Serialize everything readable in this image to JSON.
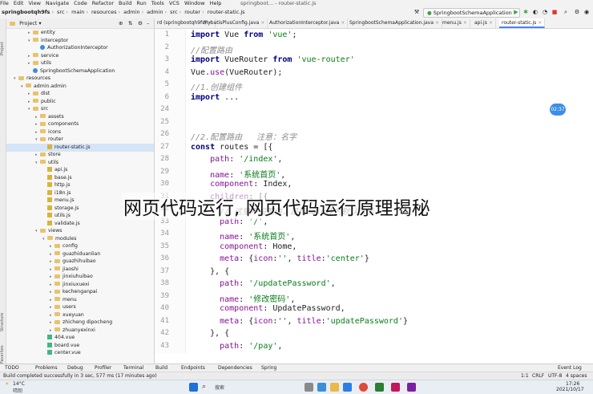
{
  "menubar": {
    "items": [
      "File",
      "Edit",
      "View",
      "Navigate",
      "Code",
      "Refactor",
      "Build",
      "Run",
      "Tools",
      "VCS",
      "Window",
      "Help"
    ],
    "title": "springboot... - router-static.js"
  },
  "navbar": {
    "crumbs": [
      "springbootqh9fs",
      "src",
      "main",
      "resources",
      "admin",
      "admin",
      "src",
      "router",
      "router-static.js"
    ],
    "run_config": "SpringbootSchemaApplication"
  },
  "project_panel": {
    "header": "Project",
    "tree": [
      {
        "label": "entity",
        "type": "folder",
        "indent": 3,
        "arrow": "▸"
      },
      {
        "label": "interceptor",
        "type": "folder",
        "indent": 3,
        "arrow": "▾"
      },
      {
        "label": "AuthorizationInterceptor",
        "type": "class",
        "indent": 4,
        "arrow": ""
      },
      {
        "label": "service",
        "type": "folder",
        "indent": 3,
        "arrow": "▸"
      },
      {
        "label": "utils",
        "type": "folder",
        "indent": 3,
        "arrow": "▸"
      },
      {
        "label": "SpringbootSchemaApplication",
        "type": "class",
        "indent": 3,
        "arrow": ""
      },
      {
        "label": "resources",
        "type": "folder",
        "indent": 1,
        "arrow": "▾"
      },
      {
        "label": "admin.admin",
        "type": "folder",
        "indent": 2,
        "arrow": "▾"
      },
      {
        "label": "dist",
        "type": "folder",
        "indent": 3,
        "arrow": "▸"
      },
      {
        "label": "public",
        "type": "folder",
        "indent": 3,
        "arrow": "▸"
      },
      {
        "label": "src",
        "type": "folder",
        "indent": 3,
        "arrow": "▾"
      },
      {
        "label": "assets",
        "type": "folder",
        "indent": 4,
        "arrow": "▸"
      },
      {
        "label": "components",
        "type": "folder",
        "indent": 4,
        "arrow": "▸"
      },
      {
        "label": "icons",
        "type": "folder",
        "indent": 4,
        "arrow": "▸"
      },
      {
        "label": "router",
        "type": "folder",
        "indent": 4,
        "arrow": "▾"
      },
      {
        "label": "router-static.js",
        "type": "js",
        "indent": 5,
        "arrow": "",
        "selected": true
      },
      {
        "label": "store",
        "type": "folder",
        "indent": 4,
        "arrow": "▸"
      },
      {
        "label": "utils",
        "type": "folder",
        "indent": 4,
        "arrow": "▾"
      },
      {
        "label": "api.js",
        "type": "js",
        "indent": 5,
        "arrow": ""
      },
      {
        "label": "base.js",
        "type": "js",
        "indent": 5,
        "arrow": ""
      },
      {
        "label": "http.js",
        "type": "js",
        "indent": 5,
        "arrow": ""
      },
      {
        "label": "i18n.js",
        "type": "js",
        "indent": 5,
        "arrow": ""
      },
      {
        "label": "menu.js",
        "type": "js",
        "indent": 5,
        "arrow": ""
      },
      {
        "label": "storage.js",
        "type": "js",
        "indent": 5,
        "arrow": ""
      },
      {
        "label": "utils.js",
        "type": "js",
        "indent": 5,
        "arrow": ""
      },
      {
        "label": "validate.js",
        "type": "js",
        "indent": 5,
        "arrow": ""
      },
      {
        "label": "views",
        "type": "folder",
        "indent": 4,
        "arrow": "▾"
      },
      {
        "label": "modules",
        "type": "folder",
        "indent": 5,
        "arrow": "▾"
      },
      {
        "label": "config",
        "type": "folder",
        "indent": 6,
        "arrow": "▸"
      },
      {
        "label": "guazhiduanlian",
        "type": "folder",
        "indent": 6,
        "arrow": "▸"
      },
      {
        "label": "guazhihuibao",
        "type": "folder",
        "indent": 6,
        "arrow": "▸"
      },
      {
        "label": "jiaoshi",
        "type": "folder",
        "indent": 6,
        "arrow": "▸"
      },
      {
        "label": "jinxiuhuibao",
        "type": "folder",
        "indent": 6,
        "arrow": "▸"
      },
      {
        "label": "jinxiuxuexi",
        "type": "folder",
        "indent": 6,
        "arrow": "▸"
      },
      {
        "label": "kechenganpai",
        "type": "folder",
        "indent": 6,
        "arrow": "▸"
      },
      {
        "label": "menu",
        "type": "folder",
        "indent": 6,
        "arrow": "▸"
      },
      {
        "label": "users",
        "type": "folder",
        "indent": 6,
        "arrow": "▸"
      },
      {
        "label": "xueyuan",
        "type": "folder",
        "indent": 6,
        "arrow": "▸"
      },
      {
        "label": "zhicheng dipocheng",
        "type": "folder",
        "indent": 6,
        "arrow": "▸"
      },
      {
        "label": "zhuanyexinxi",
        "type": "folder",
        "indent": 6,
        "arrow": "▸"
      },
      {
        "label": "404.vue",
        "type": "vue",
        "indent": 5,
        "arrow": ""
      },
      {
        "label": "board.vue",
        "type": "vue",
        "indent": 5,
        "arrow": ""
      },
      {
        "label": "center.vue",
        "type": "vue",
        "indent": 5,
        "arrow": ""
      }
    ]
  },
  "tabs": [
    {
      "label": "rd (springbootqh9fs)",
      "active": false
    },
    {
      "label": "MybatisPlusConfig.java",
      "active": false
    },
    {
      "label": "AuthorizationInterceptor.java",
      "active": false
    },
    {
      "label": "SpringbootSchemaApplication.java",
      "active": false
    },
    {
      "label": "menu.js",
      "active": false
    },
    {
      "label": "api.js",
      "active": false
    },
    {
      "label": "router-static.js",
      "active": true
    }
  ],
  "editor": {
    "lines": [
      {
        "n": "1",
        "html": "<span class='kw'>import</span> Vue <span class='kw'>from</span> <span class='str'>'vue'</span>;"
      },
      {
        "n": "2",
        "html": "<span class='cm'>//配置路由</span>"
      },
      {
        "n": "3",
        "html": "<span class='kw'>import</span> VueRouter <span class='kw'>from</span> <span class='str'>'vue-router'</span>"
      },
      {
        "n": "4",
        "html": "Vue.<span class='prop'>use</span>(VueRouter);"
      },
      {
        "n": "5",
        "html": "<span class='cm'>//1.创建组件</span>"
      },
      {
        "n": "6",
        "html": "<span class='kw'>import</span> ..."
      },
      {
        "n": "24",
        "html": ""
      },
      {
        "n": "25",
        "html": ""
      },
      {
        "n": "26",
        "html": "<span class='cm'>//2.配置路由   注意：名字</span>"
      },
      {
        "n": "27",
        "html": "<span class='kw'>const</span> routes = [{"
      },
      {
        "n": "28",
        "html": "    <span class='prop'>path</span>: <span class='str'>'/index'</span>,"
      },
      {
        "n": "29",
        "html": "    <span class='prop'>name</span>: <span class='str'>'系统首页'</span>,"
      },
      {
        "n": "30",
        "html": "    <span class='prop'>component</span>: Index,"
      },
      {
        "n": "31",
        "html": "    <span class='prop'>children</span>: [{"
      },
      {
        "n": "32",
        "html": "      <span class='cm'>// 这里不设置值，是把main作为默认页面</span>"
      },
      {
        "n": "33",
        "html": "      <span class='prop'>path</span>: <span class='str'>'/'</span>,"
      },
      {
        "n": "34",
        "html": "      <span class='prop'>name</span>: <span class='str'>'系统首页'</span>,"
      },
      {
        "n": "35",
        "html": "      <span class='prop'>component</span>: Home,"
      },
      {
        "n": "36",
        "html": "      <span class='prop'>meta</span>: {<span class='prop'>icon</span>:<span class='str'>''</span>, <span class='prop'>title</span>:<span class='str'>'center'</span>}"
      },
      {
        "n": "37",
        "html": "    }, {"
      },
      {
        "n": "38",
        "html": "      <span class='prop'>path</span>: <span class='str'>'/updatePassword'</span>,"
      },
      {
        "n": "39",
        "html": "      <span class='prop'>name</span>: <span class='str'>'修改密码'</span>,"
      },
      {
        "n": "40",
        "html": "      <span class='prop'>component</span>: UpdatePassword,"
      },
      {
        "n": "41",
        "html": "      <span class='prop'>meta</span>: {<span class='prop'>icon</span>:<span class='str'>''</span>, <span class='prop'>title</span>:<span class='str'>'updatePassword'</span>}"
      },
      {
        "n": "42",
        "html": "    }, {"
      },
      {
        "n": "43",
        "html": "      <span class='prop'>path</span>: <span class='str'>'/pay'</span>,"
      }
    ]
  },
  "badge": "02:37",
  "overlay_title": "网页代码运行, 网页代码运行原理揭秘",
  "tool_windows": [
    {
      "label": "TODO"
    },
    {
      "label": "Problems"
    },
    {
      "label": "Debug"
    },
    {
      "label": "Profiler"
    },
    {
      "label": "Terminal"
    },
    {
      "label": "Build"
    },
    {
      "label": "Endpoints"
    },
    {
      "label": "Dependencies"
    },
    {
      "label": "Spring"
    },
    {
      "label": "Event Log"
    }
  ],
  "status": {
    "message": "Build completed successfully in 3 sec, 577 ms (17 minutes ago)",
    "position": "1:1",
    "line_sep": "CRLF",
    "encoding": "UTF-8",
    "indent": "4 spaces"
  },
  "taskbar": {
    "weather": "14°C",
    "weather_sub": "晴朗",
    "search": "搜索",
    "time": "17:26",
    "date": "2021/10/17"
  },
  "colors": {
    "accent": "#4a86e8",
    "folder": "#e8c36b",
    "string": "#067d17",
    "keyword": "#000080"
  }
}
